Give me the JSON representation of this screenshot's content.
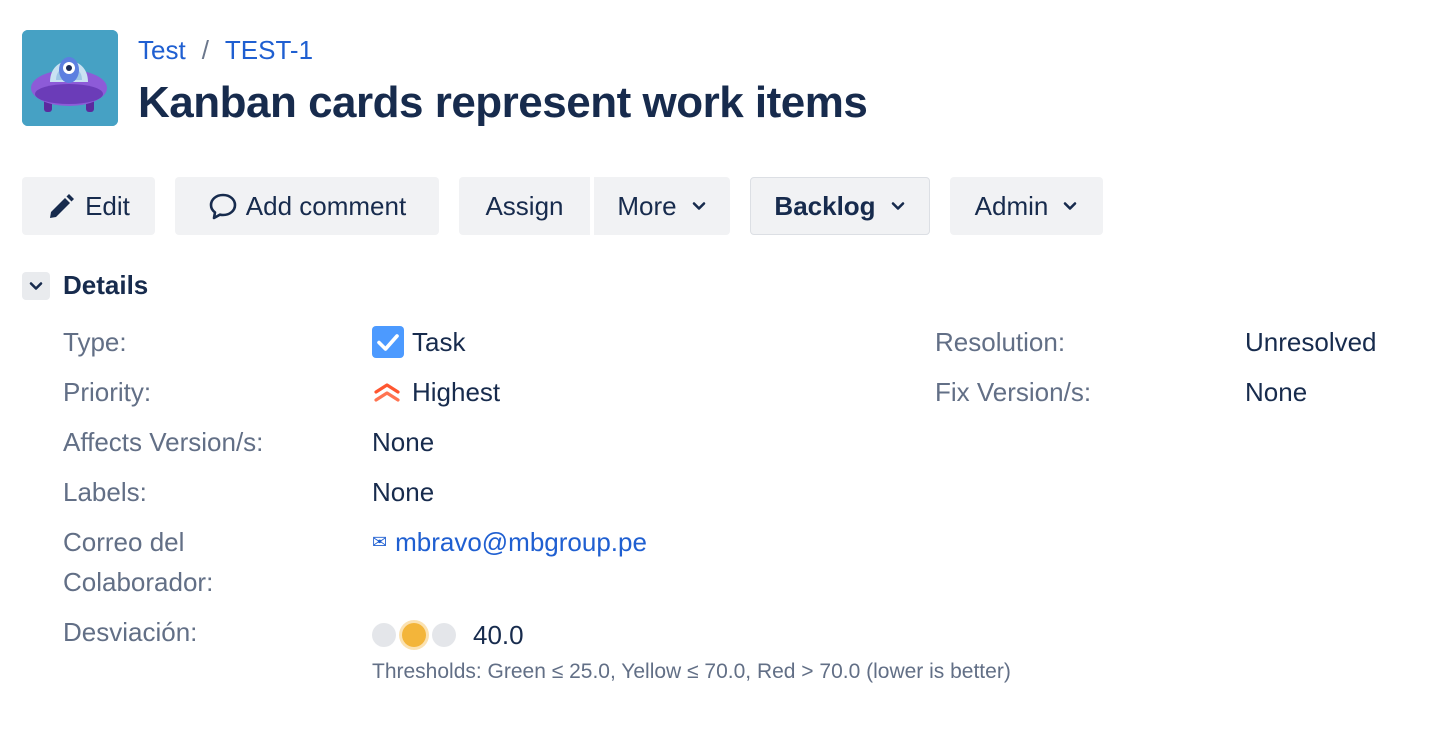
{
  "breadcrumb": {
    "project": "Test",
    "separator": "/",
    "issue_key": "TEST-1"
  },
  "issue": {
    "title": "Kanban cards represent work items"
  },
  "toolbar": {
    "edit_label": "Edit",
    "add_comment_label": "Add comment",
    "assign_label": "Assign",
    "more_label": "More",
    "status_label": "Backlog",
    "admin_label": "Admin"
  },
  "details": {
    "heading": "Details",
    "type": {
      "label": "Type:",
      "value": "Task",
      "icon": "task-checkbox-icon",
      "icon_color": "#4C9AFF"
    },
    "priority": {
      "label": "Priority:",
      "value": "Highest",
      "icon": "priority-highest-icon",
      "icon_color": "#FF5630"
    },
    "affects_versions": {
      "label": "Affects Version/s:",
      "value": "None"
    },
    "labels": {
      "label": "Labels:",
      "value": "None"
    },
    "collaborator_email": {
      "label_line1": "Correo del",
      "label_line2": "Colaborador:",
      "value": "mbravo@mbgroup.pe",
      "icon": "envelope-icon",
      "icon_glyph": "✉"
    },
    "deviation": {
      "label": "Desviación:",
      "value": "40.0",
      "active_level": "yellow",
      "thresholds_text": "Thresholds: Green ≤ 25.0, Yellow ≤ 70.0, Red > 70.0 (lower is better)",
      "colors": {
        "inactive": "#E4E6EA",
        "yellow": "#F3B53A"
      }
    },
    "resolution": {
      "label": "Resolution:",
      "value": "Unresolved"
    },
    "fix_versions": {
      "label": "Fix Version/s:",
      "value": "None"
    }
  },
  "colors": {
    "link": "#1F5FD1",
    "text": "#172B4D",
    "label": "#626F86",
    "button_bg": "#F1F2F4",
    "avatar_bg": "#46A1C4"
  }
}
